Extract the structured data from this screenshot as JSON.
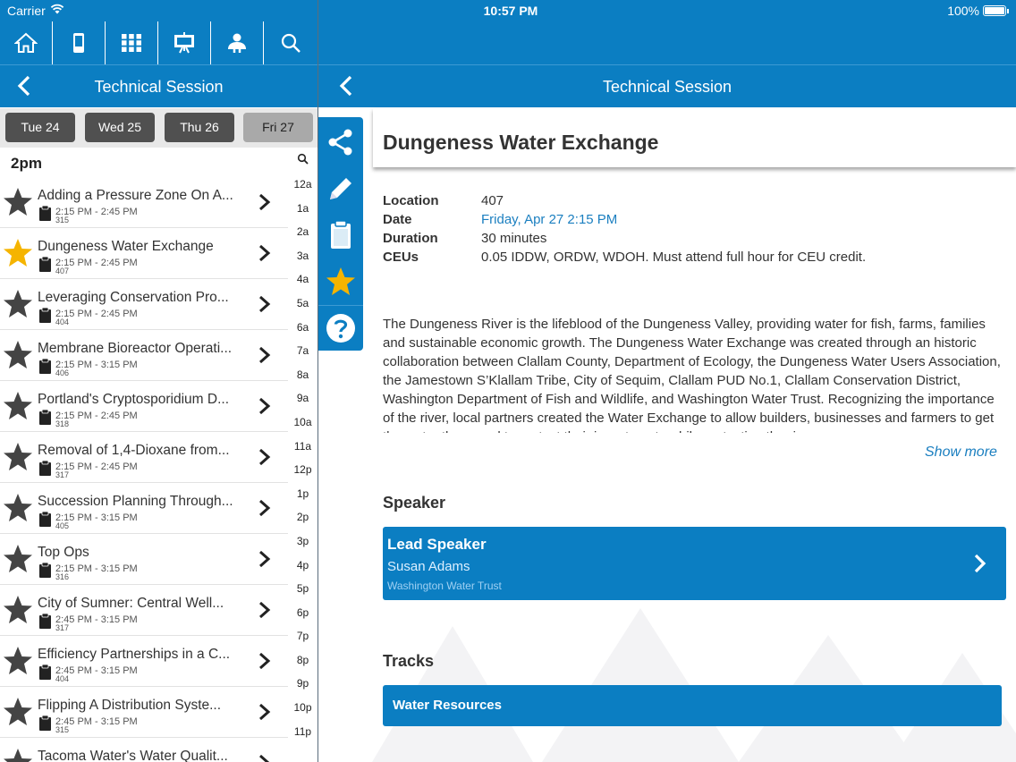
{
  "status": {
    "carrier": "Carrier",
    "time": "10:57 PM",
    "battery": "100%"
  },
  "toolbar": {
    "items": [
      "home-icon",
      "device-icon",
      "grid-icon",
      "presentation-icon",
      "person-icon",
      "search-icon"
    ]
  },
  "left_nav": {
    "title": "Technical Session"
  },
  "days": [
    {
      "label": "Tue 24",
      "active": false
    },
    {
      "label": "Wed 25",
      "active": false
    },
    {
      "label": "Thu 26",
      "active": false
    },
    {
      "label": "Fri 27",
      "active": true
    }
  ],
  "list": {
    "hour": "2pm",
    "sessions": [
      {
        "title": "Adding a Pressure Zone On A...",
        "time": "2:15 PM - 2:45 PM",
        "room": "315",
        "favorite": false
      },
      {
        "title": "Dungeness Water Exchange",
        "time": "2:15 PM - 2:45 PM",
        "room": "407",
        "favorite": true
      },
      {
        "title": "Leveraging Conservation Pro...",
        "time": "2:15 PM - 2:45 PM",
        "room": "404",
        "favorite": false
      },
      {
        "title": "Membrane Bioreactor Operati...",
        "time": "2:15 PM - 3:15 PM",
        "room": "406",
        "favorite": false
      },
      {
        "title": "Portland's Cryptosporidium D...",
        "time": "2:15 PM - 2:45 PM",
        "room": "318",
        "favorite": false
      },
      {
        "title": "Removal of 1,4-Dioxane from...",
        "time": "2:15 PM - 2:45 PM",
        "room": "317",
        "favorite": false
      },
      {
        "title": "Succession Planning Through...",
        "time": "2:15 PM - 3:15 PM",
        "room": "405",
        "favorite": false
      },
      {
        "title": "Top Ops",
        "time": "2:15 PM - 3:15 PM",
        "room": "316",
        "favorite": false
      },
      {
        "title": "City of Sumner: Central Well...",
        "time": "2:45 PM - 3:15 PM",
        "room": "317",
        "favorite": false
      },
      {
        "title": "Efficiency Partnerships in a C...",
        "time": "2:45 PM - 3:15 PM",
        "room": "404",
        "favorite": false
      },
      {
        "title": "Flipping A Distribution Syste...",
        "time": "2:45 PM - 3:15 PM",
        "room": "315",
        "favorite": false
      },
      {
        "title": "Tacoma Water's Water Qualit...",
        "time": "",
        "room": "",
        "favorite": false
      }
    ],
    "hour_index": [
      "12a",
      "1a",
      "2a",
      "3a",
      "4a",
      "5a",
      "6a",
      "7a",
      "8a",
      "9a",
      "10a",
      "11a",
      "12p",
      "1p",
      "2p",
      "3p",
      "4p",
      "5p",
      "6p",
      "7p",
      "8p",
      "9p",
      "10p",
      "11p"
    ]
  },
  "right_nav": {
    "title": "Technical Session"
  },
  "side_tools": [
    "share-icon",
    "pencil-icon",
    "clipboard-icon",
    "star-icon",
    "help-icon"
  ],
  "detail": {
    "title": "Dungeness Water Exchange",
    "info": [
      {
        "label": "Location",
        "value": "407",
        "link": false
      },
      {
        "label": "Date",
        "value": "Friday, Apr 27 2:15 PM",
        "link": true
      },
      {
        "label": "Duration",
        "value": "30 minutes",
        "link": false
      },
      {
        "label": "CEUs",
        "value": "0.05 IDDW, ORDW, WDOH.  Must attend full hour for CEU credit.",
        "link": false
      }
    ],
    "description": "The Dungeness River is the lifeblood of the Dungeness Valley, providing water for fish, farms, families and sustainable economic growth. The Dungeness Water Exchange was created through an historic collaboration between Clallam County, Department of Ecology, the Dungeness Water Users Association, the Jamestown S’Klallam Tribe, City of Sequim, Clallam PUD No.1, Clallam Conservation District, Washington Department of Fish and Wildlife, and Washington Water Trust. Recognizing the importance of the river, local partners created the Water Exchange to allow builders, businesses and farmers to get the water they need to protect their investments while protecting the river.",
    "show_more": "Show more",
    "speaker_heading": "Speaker",
    "speaker": {
      "role": "Lead Speaker",
      "name": "Susan Adams",
      "org": "Washington Water Trust"
    },
    "tracks_heading": "Tracks",
    "tracks": [
      "Water Resources"
    ]
  },
  "colors": {
    "accent": "#0b7ec2",
    "link": "#1b7fc0",
    "favorite": "#f5b400"
  }
}
